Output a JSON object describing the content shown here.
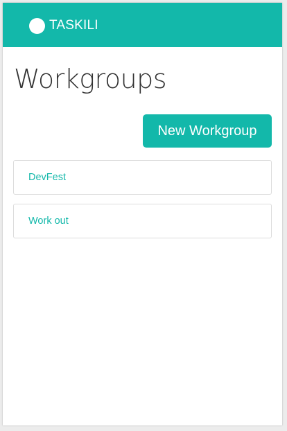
{
  "brand": {
    "name": "TASKILI",
    "accent_color": "#13b8aa",
    "logo_icon": "circle-logo-icon"
  },
  "page": {
    "title": "Workgroups"
  },
  "actions": {
    "new_workgroup_label": "New Workgroup"
  },
  "workgroups": [
    {
      "name": "DevFest"
    },
    {
      "name": "Work out"
    }
  ]
}
